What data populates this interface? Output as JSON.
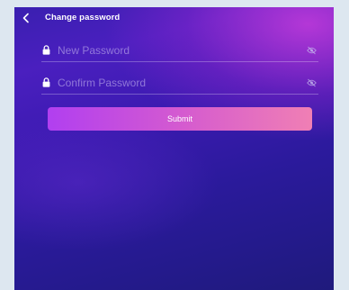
{
  "header": {
    "title": "Change password",
    "back_icon": "chevron-left-icon"
  },
  "form": {
    "new_password": {
      "placeholder": "New Password",
      "value": "",
      "lock_icon": "lock-icon",
      "toggle_icon": "eye-slash-icon"
    },
    "confirm_password": {
      "placeholder": "Confirm Password",
      "value": "",
      "lock_icon": "lock-icon",
      "toggle_icon": "eye-slash-icon"
    },
    "submit_label": "Submit"
  },
  "colors": {
    "background_top": "#4a1fbf",
    "background_bottom": "#1f1a7c",
    "accent_glow": "#c83cdc",
    "button_start": "#b13ff0",
    "button_end": "#f07fb4",
    "text": "#ffffff"
  }
}
